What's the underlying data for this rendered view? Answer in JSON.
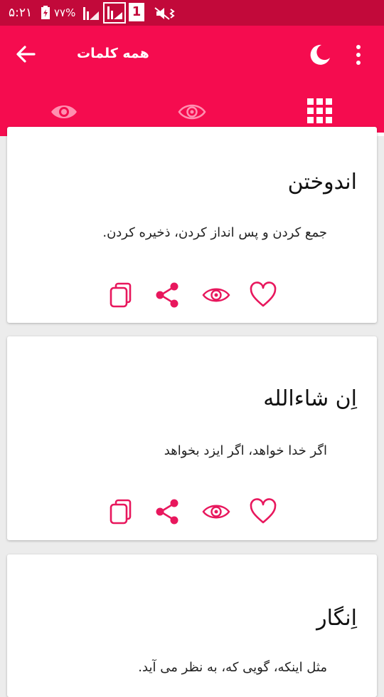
{
  "status_bar": {
    "time": "۵:۲۱",
    "battery_percent": "۷۷%",
    "sim_slot": "1"
  },
  "app_bar": {
    "title": "همه کلمات",
    "icons": [
      "arrow-back-icon",
      "moon-icon",
      "more-vert-icon"
    ]
  },
  "tabs": [
    {
      "name": "viewed-words",
      "icon": "eye-icon",
      "selected": false
    },
    {
      "name": "unviewed-words",
      "icon": "eye-outline-icon",
      "selected": false
    },
    {
      "name": "all-words",
      "icon": "grid-icon",
      "selected": true
    }
  ],
  "colors": {
    "primary": "#f50c4f",
    "status_bar": "#c2093a",
    "accent": "#e8175d",
    "background": "#ececec"
  },
  "cards": [
    {
      "word": "اندوختن",
      "meaning": "جمع کردن و پس انداز کردن، ذخیره کردن."
    },
    {
      "word": "اِن شاءالله",
      "meaning": "اگر خدا خواهد، اگر ایزد بخواهد"
    },
    {
      "word": "اِنگار",
      "meaning": "مثل اینکه، گویی که، به نظر می آید."
    }
  ],
  "card_actions": [
    "copy-icon",
    "share-icon",
    "eye-icon",
    "heart-icon"
  ]
}
